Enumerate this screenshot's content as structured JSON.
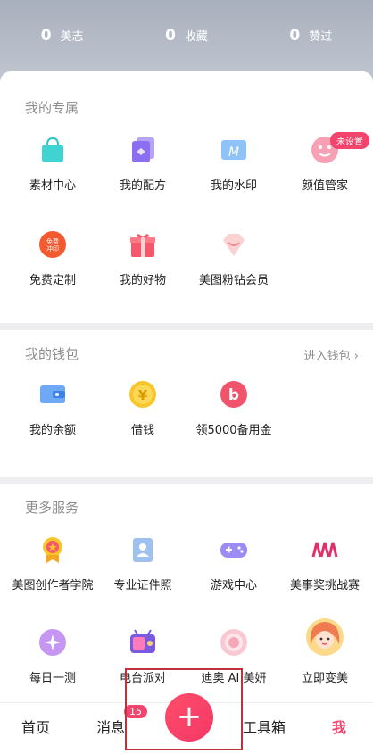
{
  "stats": [
    {
      "num": "0",
      "label": "美志"
    },
    {
      "num": "0",
      "label": "收藏"
    },
    {
      "num": "0",
      "label": "赞过"
    }
  ],
  "exclusive": {
    "title": "我的专属",
    "badge": "未设置",
    "items": [
      {
        "label": "素材中心",
        "icon": "shopping-bag-icon"
      },
      {
        "label": "我的配方",
        "icon": "layers-icon"
      },
      {
        "label": "我的水印",
        "icon": "watermark-icon"
      },
      {
        "label": "颜值管家",
        "icon": "smiley-face-icon"
      },
      {
        "label": "免费定制",
        "icon": "free-print-icon"
      },
      {
        "label": "我的好物",
        "icon": "gift-box-icon"
      },
      {
        "label": "美图粉钻会员",
        "icon": "diamond-icon"
      }
    ]
  },
  "wallet": {
    "title": "我的钱包",
    "link": "进入钱包 ›",
    "items": [
      {
        "label": "我的余额",
        "icon": "wallet-icon"
      },
      {
        "label": "借钱",
        "icon": "yen-coin-icon"
      },
      {
        "label": "领5000备用金",
        "icon": "b-coin-icon"
      }
    ]
  },
  "more": {
    "title": "更多服务",
    "items": [
      {
        "label": "美图创作者学院",
        "icon": "medal-icon"
      },
      {
        "label": "专业证件照",
        "icon": "id-photo-icon"
      },
      {
        "label": "游戏中心",
        "icon": "gamepad-icon"
      },
      {
        "label": "美事奖挑战赛",
        "icon": "award-logo-icon"
      },
      {
        "label": "每日一测",
        "icon": "sparkle-icon"
      },
      {
        "label": "电台派对",
        "icon": "radio-icon"
      },
      {
        "label": "迪奥 AI 美妍",
        "icon": "dior-icon"
      },
      {
        "label": "立即变美",
        "icon": "avatar-girl-icon"
      }
    ]
  },
  "nav": {
    "home": "首页",
    "messages": "消息",
    "badge": "15",
    "plus": "+",
    "tools": "工具箱",
    "me": "我"
  },
  "colors": {
    "accent": "#f2446d"
  }
}
